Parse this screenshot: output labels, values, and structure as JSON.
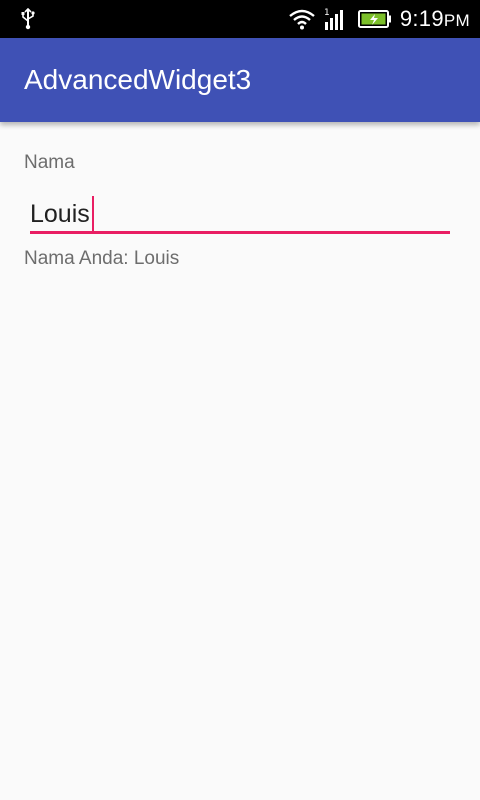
{
  "status_bar": {
    "time": "9:19",
    "ampm": "PM",
    "icons": [
      "usb-icon",
      "wifi-icon",
      "signal-icon",
      "battery-charging-icon"
    ],
    "signal_label": "1",
    "battery_color": "#7cbf2a"
  },
  "app_bar": {
    "title": "AdvancedWidget3",
    "color": "#3f51b5"
  },
  "form": {
    "label": "Nama",
    "input_value": "Louis",
    "accent_color": "#e91e63",
    "result_text": "Nama Anda: Louis"
  }
}
